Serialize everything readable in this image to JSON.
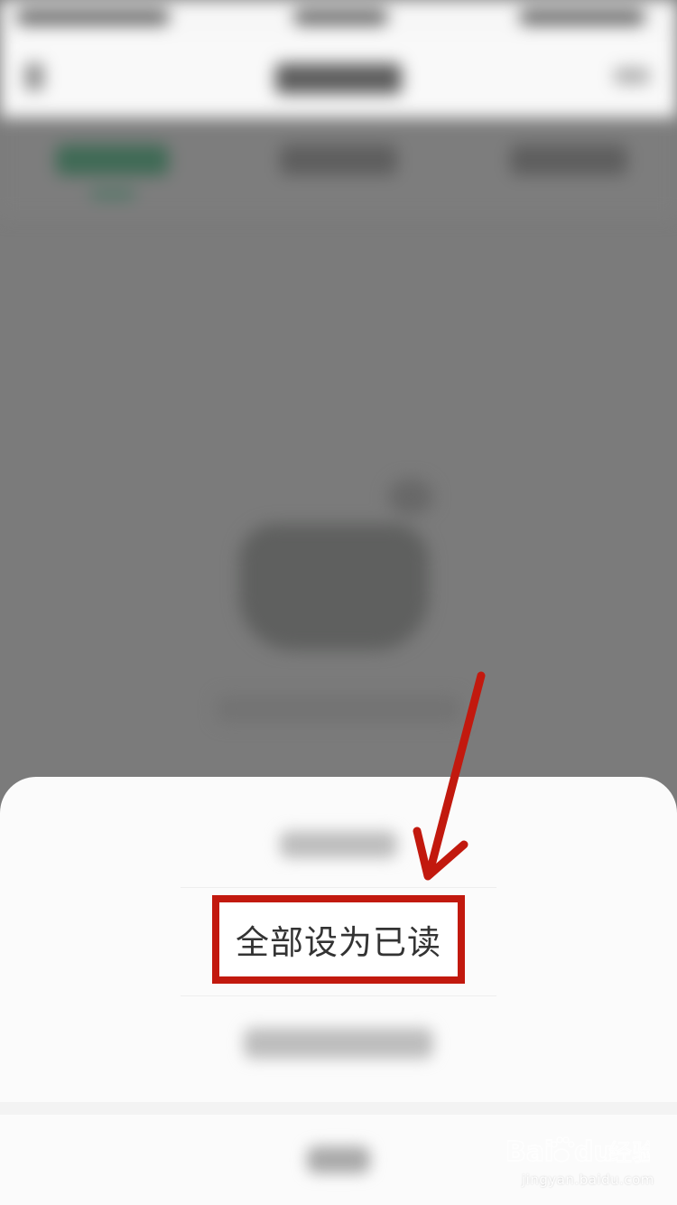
{
  "action_sheet": {
    "highlighted_option": "全部设为已读"
  },
  "annotation": {
    "highlight_color": "#c2190e",
    "arrow_icon": "arrow-pointer-icon"
  },
  "watermark": {
    "brand": "Baidu经验",
    "url": "jingyan.baidu.com"
  }
}
